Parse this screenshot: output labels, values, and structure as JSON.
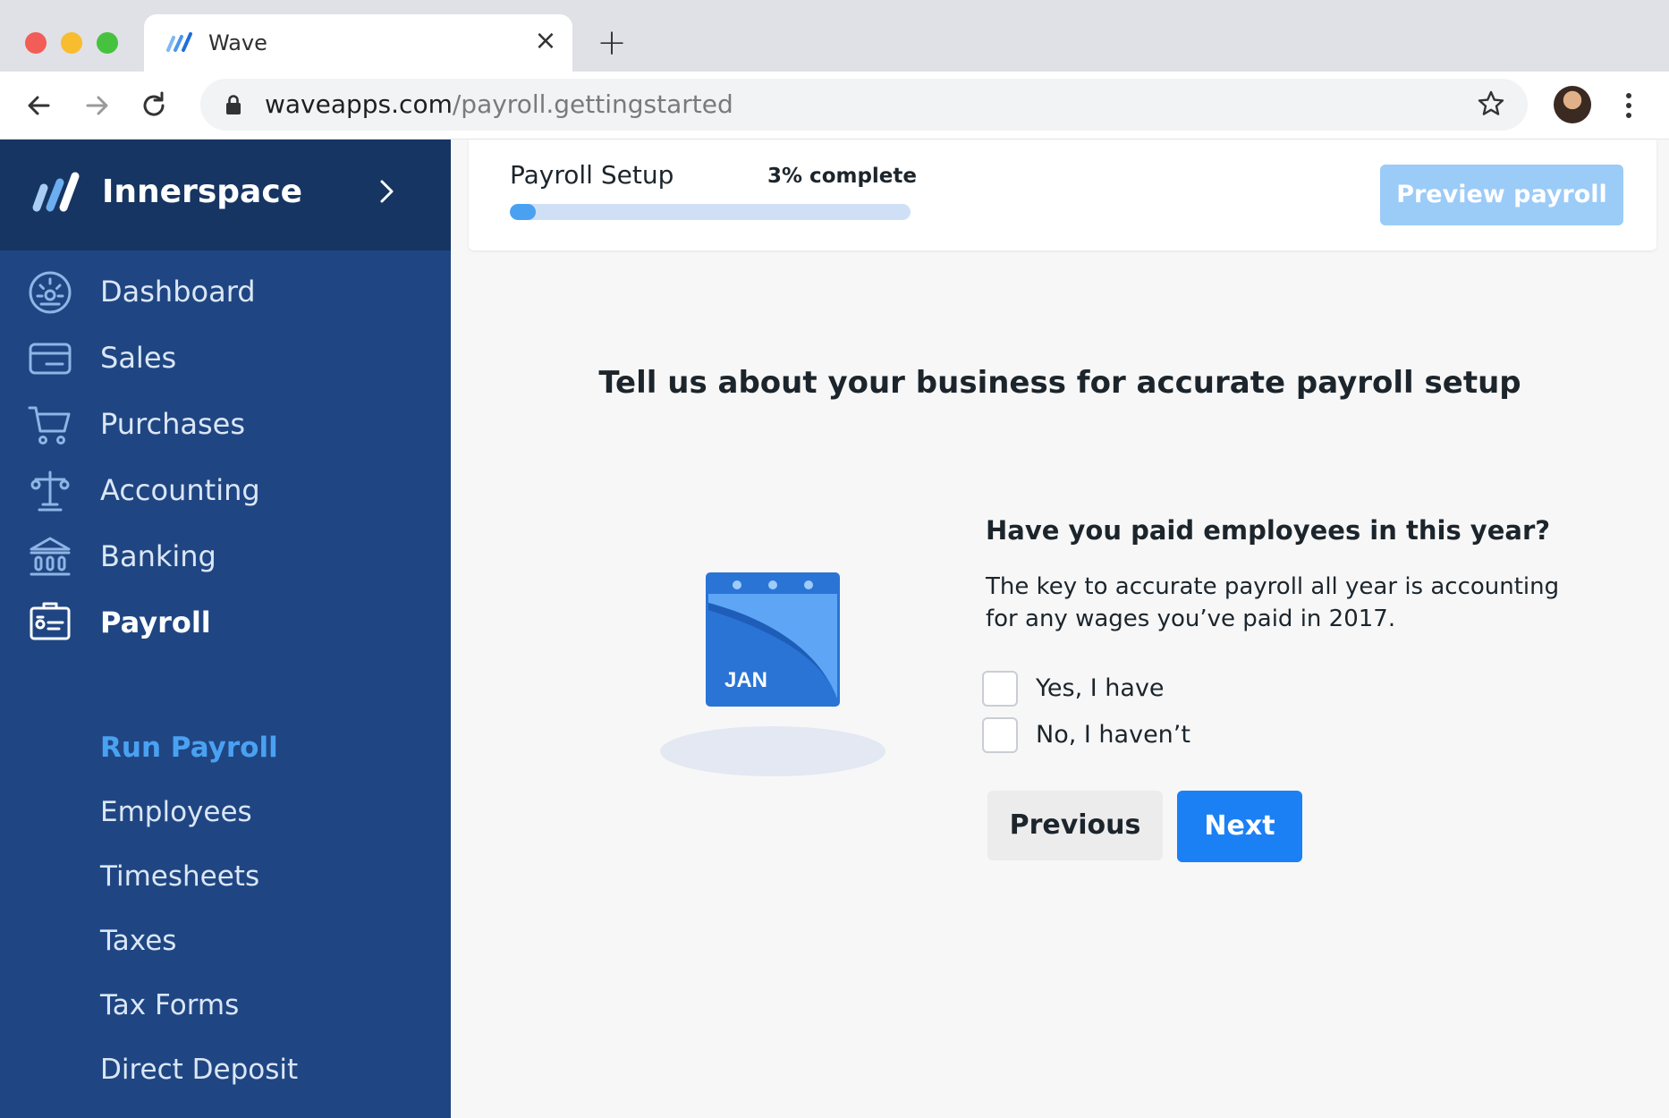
{
  "browser": {
    "tab_title": "Wave",
    "url_domain": "waveapps.com",
    "url_path": "/payroll.gettingstarted",
    "icons": [
      "back-arrow-icon",
      "forward-arrow-icon",
      "reload-icon",
      "lock-icon",
      "star-icon",
      "avatar",
      "more-menu-icon"
    ]
  },
  "sidebar": {
    "business_name": "Innerspace",
    "items": [
      {
        "label": "Dashboard",
        "icon": "dashboard-icon"
      },
      {
        "label": "Sales",
        "icon": "credit-card-icon"
      },
      {
        "label": "Purchases",
        "icon": "cart-icon"
      },
      {
        "label": "Accounting",
        "icon": "scales-icon"
      },
      {
        "label": "Banking",
        "icon": "bank-icon"
      },
      {
        "label": "Payroll",
        "icon": "id-card-icon",
        "active": true
      }
    ],
    "sub_items": [
      {
        "label": "Run Payroll",
        "active": true
      },
      {
        "label": "Employees"
      },
      {
        "label": "Timesheets"
      },
      {
        "label": "Taxes"
      },
      {
        "label": "Tax Forms"
      },
      {
        "label": "Direct Deposit"
      }
    ]
  },
  "setup": {
    "title": "Payroll Setup",
    "percent_label": "3% complete",
    "progress": 0.03,
    "preview_button": "Preview payroll"
  },
  "main": {
    "headline": "Tell us about your business for accurate payroll setup",
    "calendar_month": "JAN",
    "question": "Have you paid employees in this year?",
    "description": "The key to accurate payroll all year is accounting for any wages you’ve paid in 2017.",
    "options": [
      {
        "label": "Yes, I have",
        "checked": false
      },
      {
        "label": "No, I haven’t",
        "checked": false
      }
    ],
    "previous_button": "Previous",
    "next_button": "Next"
  },
  "colors": {
    "sidebar_bg": "#1f4682",
    "brand_bg": "#163562",
    "accent": "#1c80f5",
    "active_sub_item": "#4aa1f2",
    "preview_button_disabled": "#9bcbf7"
  }
}
